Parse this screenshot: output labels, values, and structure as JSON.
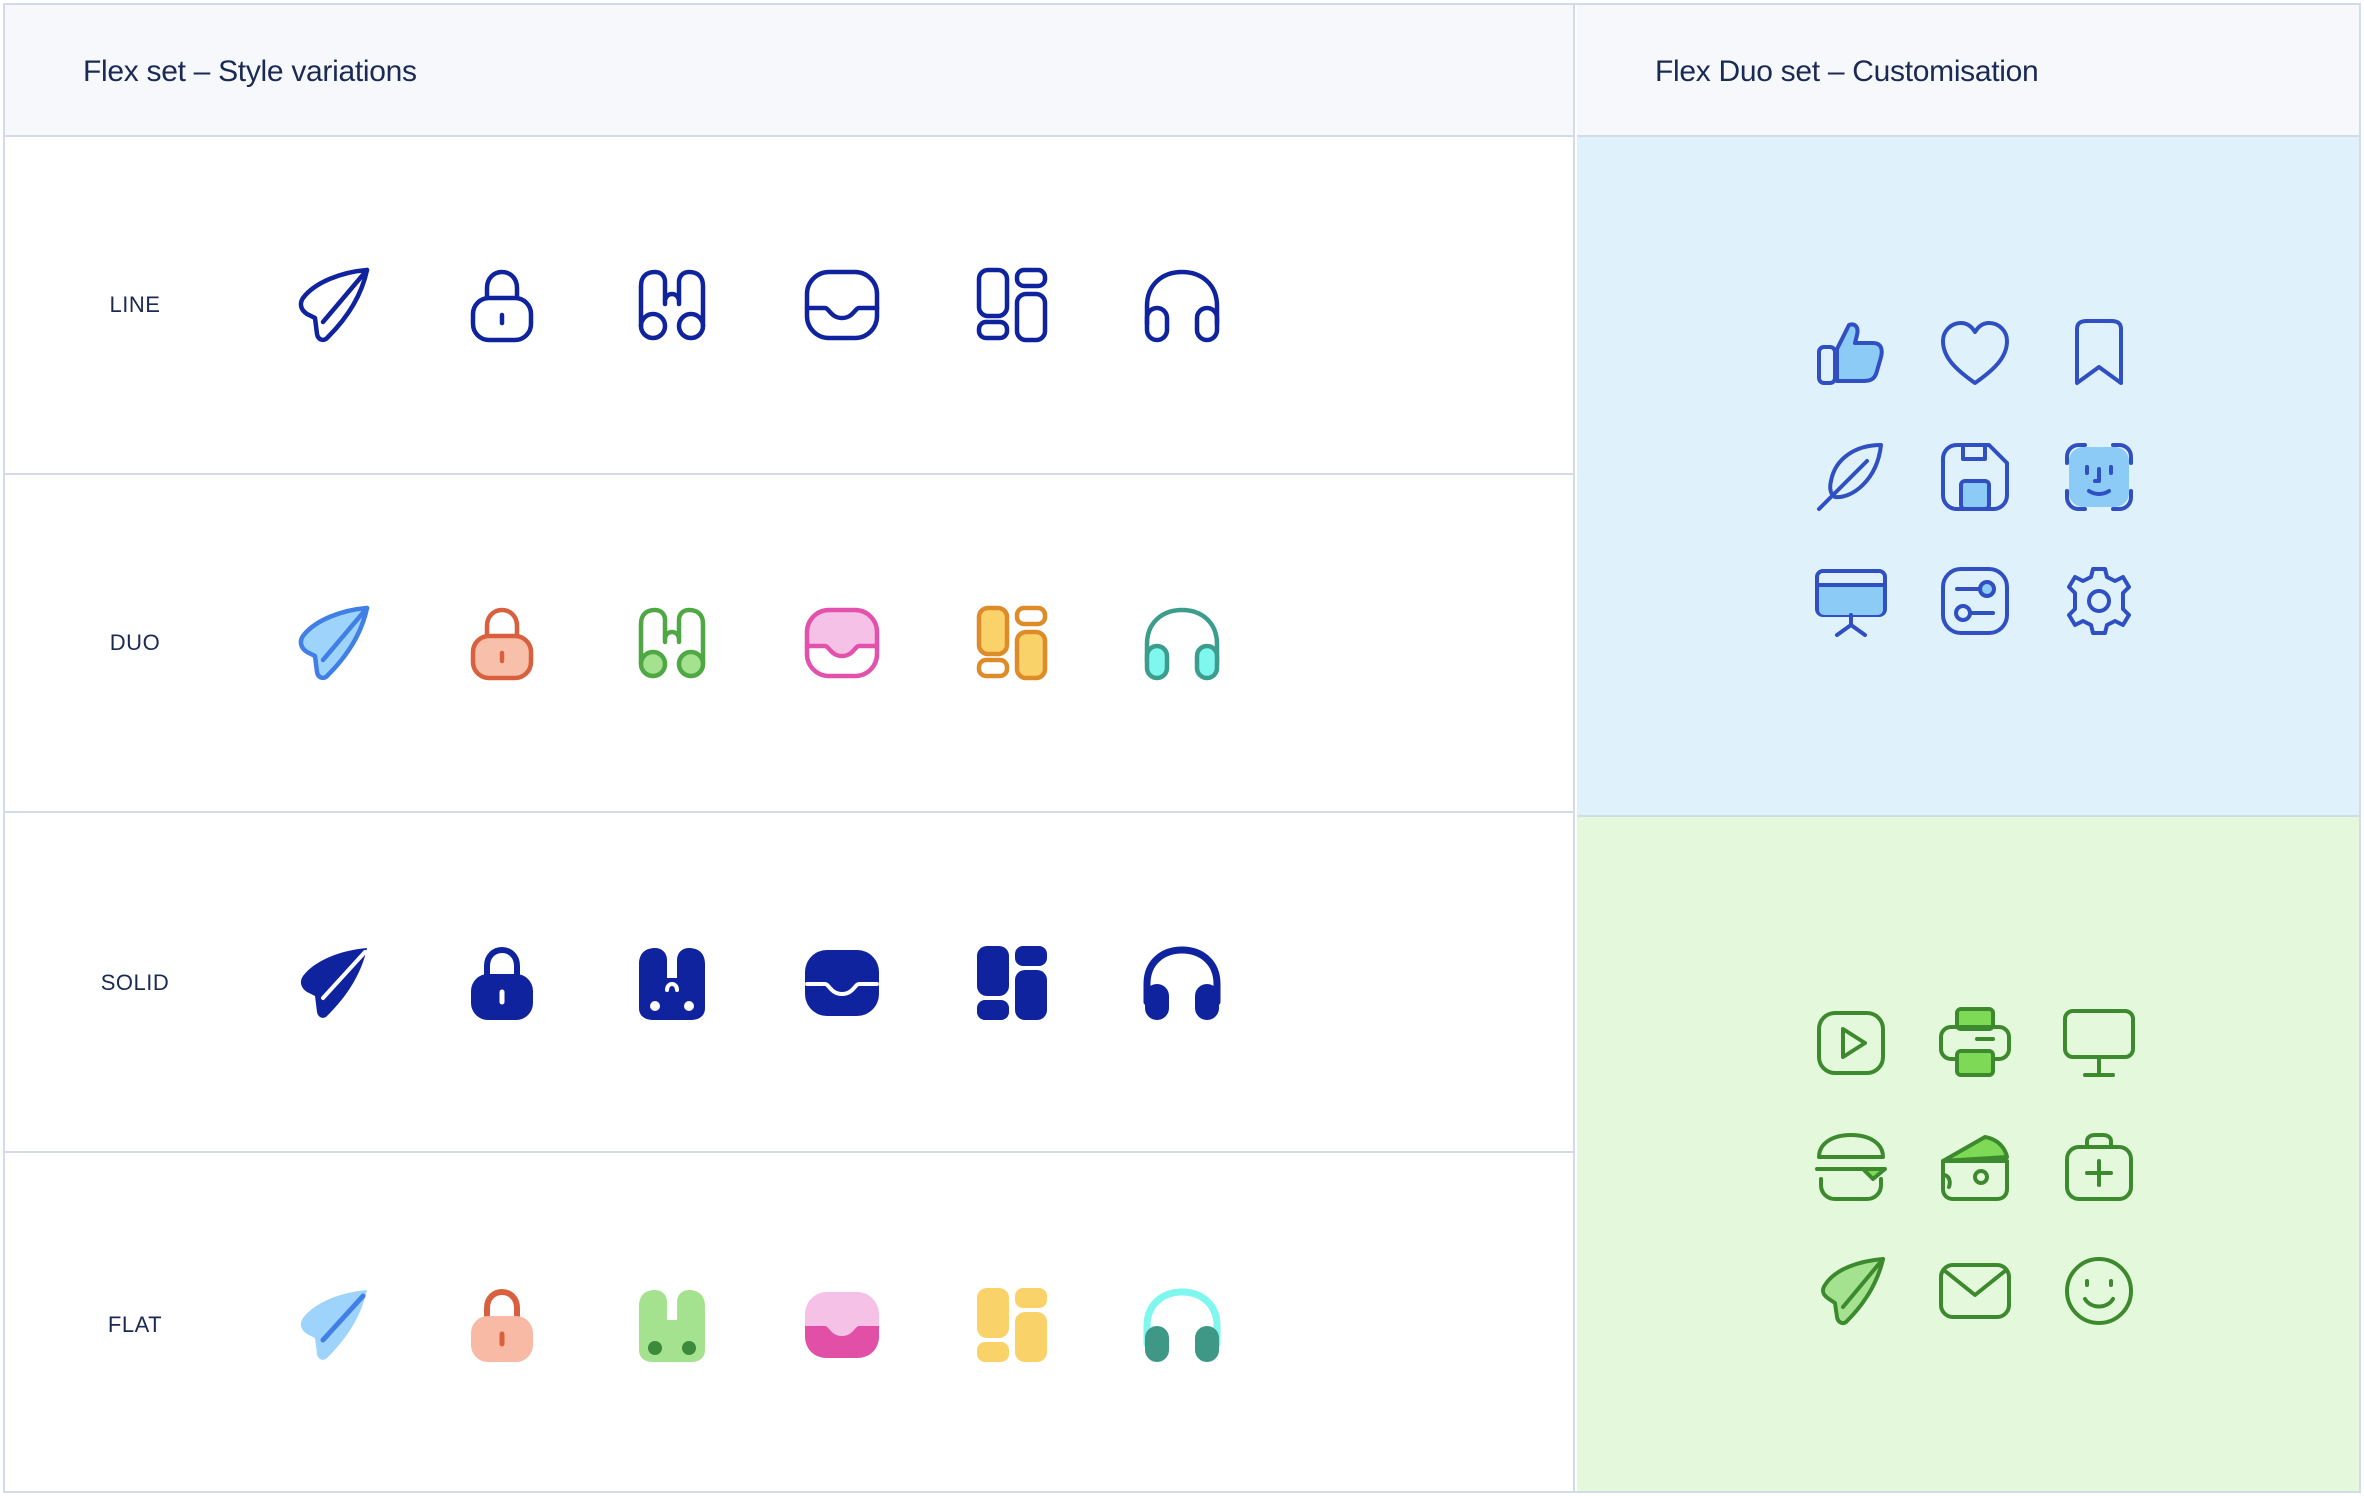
{
  "left_header": {
    "title": "Flex set – Style variations"
  },
  "right_header": {
    "title": "Flex Duo set – Customisation"
  },
  "rows": [
    {
      "label": "LINE"
    },
    {
      "label": "DUO"
    },
    {
      "label": "SOLID"
    },
    {
      "label": "FLAT"
    }
  ],
  "icons": [
    "paper-plane-icon",
    "lock-icon",
    "binoculars-icon",
    "inbox-icon",
    "dashboard-icon",
    "headphones-icon"
  ],
  "blue_panel": {
    "icons": [
      "thumbs-up-icon",
      "heart-icon",
      "bookmark-icon",
      "feather-icon",
      "floppy-disk-icon",
      "face-id-icon",
      "presentation-board-icon",
      "sliders-icon",
      "gear-icon"
    ]
  },
  "green_panel": {
    "icons": [
      "play-button-icon",
      "printer-icon",
      "monitor-icon",
      "burger-icon",
      "cheese-icon",
      "first-aid-kit-icon",
      "paper-plane-icon",
      "mail-icon",
      "smiley-icon"
    ]
  },
  "colors": {
    "navy": "#10239e",
    "blue_panel_bg": "#dff1fb",
    "green_panel_bg": "#e4f8dc",
    "header_bg": "#f6f8fb",
    "border": "#d3dbe8"
  }
}
